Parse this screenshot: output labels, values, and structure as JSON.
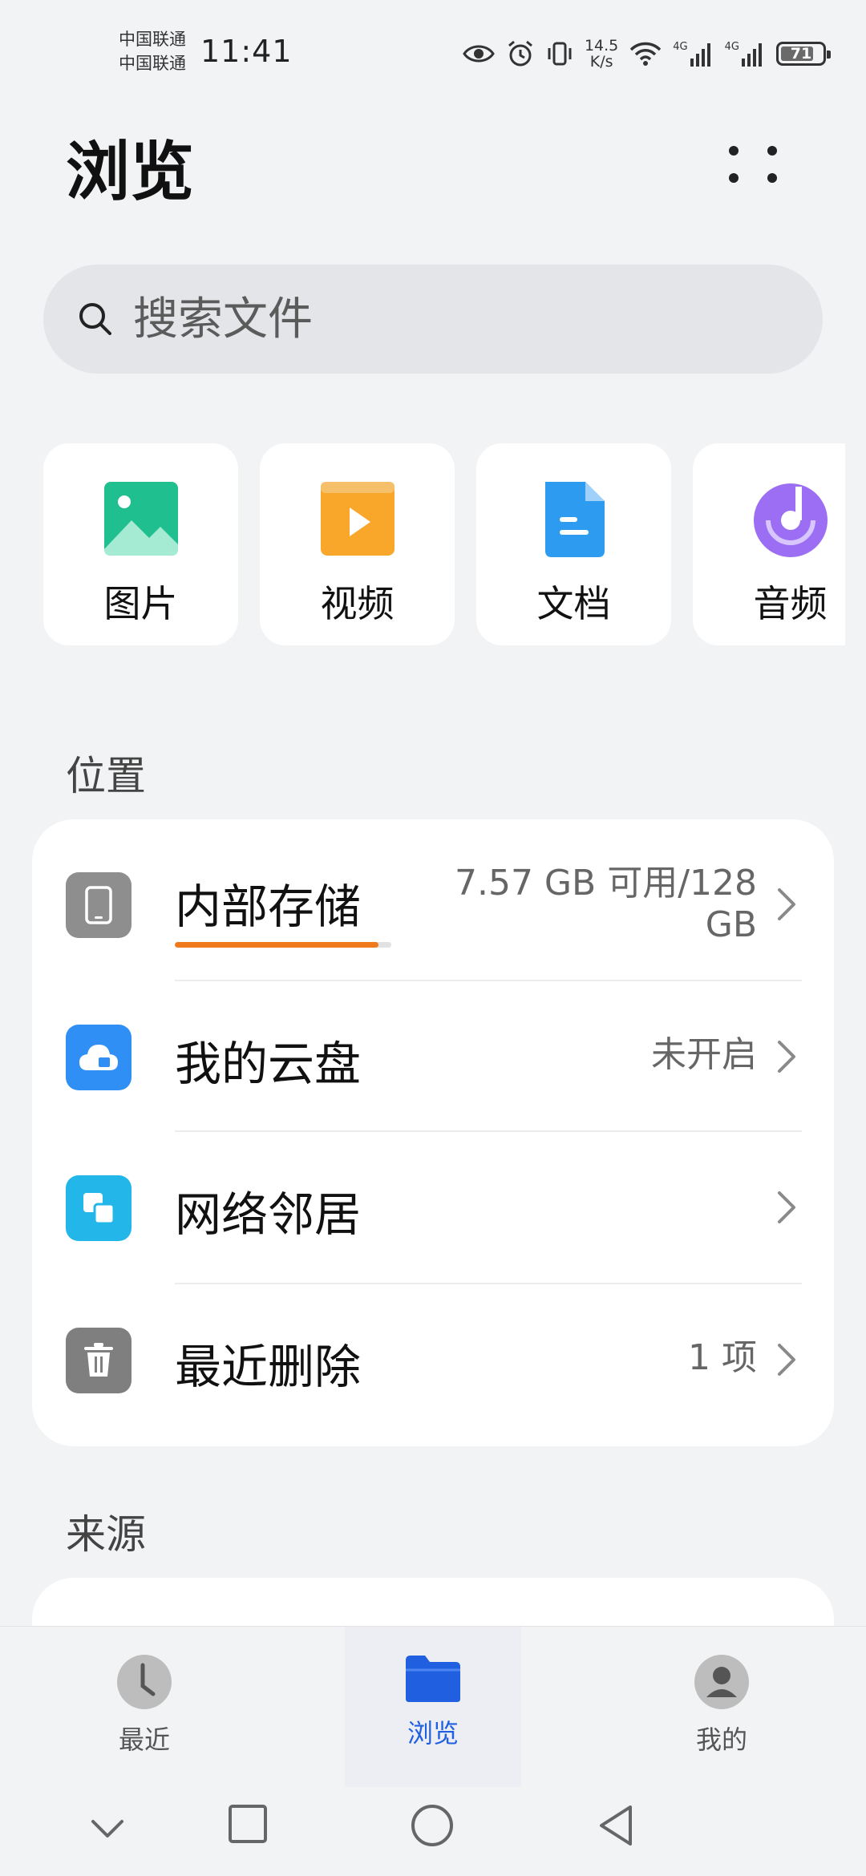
{
  "status_bar": {
    "carrier_1": "中国联通",
    "carrier_2": "中国联通",
    "time": "11:41",
    "net_speed_value": "14.5",
    "net_speed_unit": "K/s",
    "signal_1_label": "4G",
    "signal_2_label": "4G",
    "battery_level": "71",
    "icons": [
      "eye-icon",
      "alarm-icon",
      "vibrate-icon",
      "wifi-icon",
      "signal-icon",
      "signal-icon",
      "battery-icon"
    ]
  },
  "header": {
    "title": "浏览"
  },
  "search": {
    "placeholder": "搜索文件"
  },
  "categories": [
    {
      "label": "图片",
      "icon": "image-icon",
      "color": "#1fbf8f"
    },
    {
      "label": "视频",
      "icon": "video-icon",
      "color": "#f9a72b"
    },
    {
      "label": "文档",
      "icon": "document-icon",
      "color": "#2d9bf0"
    },
    {
      "label": "音频",
      "icon": "audio-icon",
      "color": "#9b6ef3"
    }
  ],
  "locations": {
    "title": "位置",
    "items": [
      {
        "name": "内部存储",
        "value_line1": "7.57 GB 可用/128",
        "value_line2": "GB",
        "icon": "phone-icon",
        "color": "#8e8e8e",
        "usage_fraction": 0.94
      },
      {
        "name": "我的云盘",
        "value": "未开启",
        "icon": "cloud-icon",
        "color": "#2f8ff5"
      },
      {
        "name": "网络邻居",
        "value": "",
        "icon": "network-icon",
        "color": "#22b7e8"
      },
      {
        "name": "最近删除",
        "value": "1 项",
        "icon": "trash-icon",
        "color": "#7f7f7f"
      }
    ]
  },
  "sources": {
    "title": "来源"
  },
  "bottom_nav": {
    "items": [
      {
        "label": "最近",
        "icon": "clock-icon",
        "active": false
      },
      {
        "label": "浏览",
        "icon": "folder-icon",
        "active": true
      },
      {
        "label": "我的",
        "icon": "profile-icon",
        "active": false
      }
    ]
  },
  "colors": {
    "accent": "#1f5fe0",
    "storage_bar": "#ee7a1c",
    "background": "#f1f3f5"
  }
}
